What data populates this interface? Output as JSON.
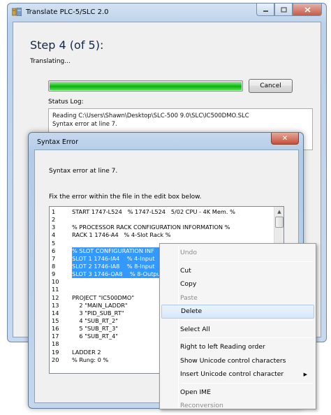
{
  "main_window": {
    "title": "Translate PLC-5/SLC 2.0",
    "step_title": "Step 4 (of 5):",
    "status_text": "Translating...",
    "progress": 1.0,
    "cancel_label": "Cancel",
    "status_log_label": "Status Log:",
    "status_log_lines": [
      "Reading C:\\Users\\Shawn\\Desktop\\SLC-500 9.0\\SLC\\IC500DMO.SLC",
      "Syntax error at line 7."
    ]
  },
  "dialog": {
    "title": "Syntax Error",
    "close_glyph": "✕",
    "message": "Syntax error at line 7.",
    "instruction": "Fix the error within the file in the edit box below.",
    "lines": [
      {
        "num": "1",
        "text": "START 1747-L524   % 1747-L524   5/02 CPU - 4K Mem. %",
        "selected": false
      },
      {
        "num": "2",
        "text": "",
        "selected": false
      },
      {
        "num": "3",
        "text": "% PROCESSOR RACK CONFIGURATION INFORMATION %",
        "selected": false
      },
      {
        "num": "4",
        "text": "RACK 1 1746-A4   % 4-Slot Rack %",
        "selected": false
      },
      {
        "num": "5",
        "text": "",
        "selected": false
      },
      {
        "num": "6",
        "text": "% SLOT CONFIGURATION INF",
        "selected": true
      },
      {
        "num": "7",
        "text": "SLOT 1 1746-IA4    % 4-Input",
        "selected": true
      },
      {
        "num": "8",
        "text": "SLOT 2 1746-IA8    % 8-Input",
        "selected": true
      },
      {
        "num": "9",
        "text": "SLOT 3 1746-OA8    % 8-Outpu",
        "selected": true
      },
      {
        "num": "10",
        "text": "",
        "selected": false
      },
      {
        "num": "11",
        "text": "",
        "selected": false
      },
      {
        "num": "12",
        "text": "PROJECT \"IC500DMO\"",
        "selected": false
      },
      {
        "num": "13",
        "text": "    2 \"MAIN_LADDR\"",
        "selected": false
      },
      {
        "num": "14",
        "text": "    3 \"PID_SUB_RT\"",
        "selected": false
      },
      {
        "num": "15",
        "text": "    4 \"SUB_RT_2\"",
        "selected": false
      },
      {
        "num": "16",
        "text": "    5 \"SUB_RT_3\"",
        "selected": false
      },
      {
        "num": "17",
        "text": "    6 \"SUB_RT_4\"",
        "selected": false
      },
      {
        "num": "18",
        "text": "",
        "selected": false
      },
      {
        "num": "19",
        "text": "LADDER 2",
        "selected": false
      },
      {
        "num": "20",
        "text": "% Rung: 0 %",
        "selected": false
      }
    ]
  },
  "context_menu": {
    "items": [
      {
        "label": "Undo",
        "disabled": true,
        "highlighted": false,
        "submenu": false
      },
      {
        "sep": true
      },
      {
        "label": "Cut",
        "disabled": false,
        "highlighted": false,
        "submenu": false
      },
      {
        "label": "Copy",
        "disabled": false,
        "highlighted": false,
        "submenu": false
      },
      {
        "label": "Paste",
        "disabled": true,
        "highlighted": false,
        "submenu": false
      },
      {
        "label": "Delete",
        "disabled": false,
        "highlighted": true,
        "submenu": false
      },
      {
        "sep": true
      },
      {
        "label": "Select All",
        "disabled": false,
        "highlighted": false,
        "submenu": false
      },
      {
        "sep": true
      },
      {
        "label": "Right to left Reading order",
        "disabled": false,
        "highlighted": false,
        "submenu": false
      },
      {
        "label": "Show Unicode control characters",
        "disabled": false,
        "highlighted": false,
        "submenu": false
      },
      {
        "label": "Insert Unicode control character",
        "disabled": false,
        "highlighted": false,
        "submenu": true
      },
      {
        "sep": true
      },
      {
        "label": "Open IME",
        "disabled": false,
        "highlighted": false,
        "submenu": false
      },
      {
        "label": "Reconversion",
        "disabled": true,
        "highlighted": false,
        "submenu": false
      }
    ]
  },
  "colors": {
    "progress_green": "#1fc41f",
    "selection": "#3399ff",
    "menu_highlight": "#d7e8fa"
  },
  "icons": {
    "app": "translate-app-icon",
    "minimize": "minimize-icon",
    "maximize": "maximize-icon",
    "close": "close-icon",
    "submenu": "chevron-right-icon"
  }
}
